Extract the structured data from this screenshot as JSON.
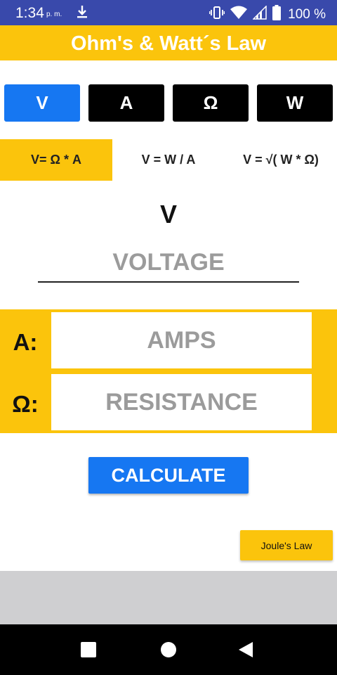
{
  "status_bar": {
    "time": "1:34",
    "ampm": "p. m.",
    "battery_percent": "100 %",
    "icons": [
      "download-icon",
      "vibrate-icon",
      "wifi-icon",
      "signal-icon",
      "battery-icon"
    ]
  },
  "app": {
    "title": "Ohm's & Watt´s Law"
  },
  "unit_tabs": [
    {
      "label": "V",
      "active": true
    },
    {
      "label": "A",
      "active": false
    },
    {
      "label": "Ω",
      "active": false
    },
    {
      "label": "W",
      "active": false
    }
  ],
  "formula_tabs": [
    {
      "label": "V= Ω * A",
      "active": true
    },
    {
      "label": "V = W / A",
      "active": false
    },
    {
      "label": "V = √( W * Ω)",
      "active": false
    }
  ],
  "result": {
    "unit": "V",
    "placeholder": "VOLTAGE",
    "value": ""
  },
  "inputs": {
    "amps": {
      "label": "A:",
      "placeholder": "AMPS",
      "value": ""
    },
    "resistance": {
      "label": "Ω:",
      "placeholder": "RESISTANCE",
      "value": ""
    }
  },
  "buttons": {
    "calculate": "CALCULATE",
    "joule": "Joule's Law"
  },
  "colors": {
    "accent_yellow": "#fbc40c",
    "active_blue": "#1677f2",
    "status_bar": "#3949ab"
  },
  "nav_bar": {
    "icons": [
      "recents-square-icon",
      "home-circle-icon",
      "back-triangle-icon"
    ]
  }
}
